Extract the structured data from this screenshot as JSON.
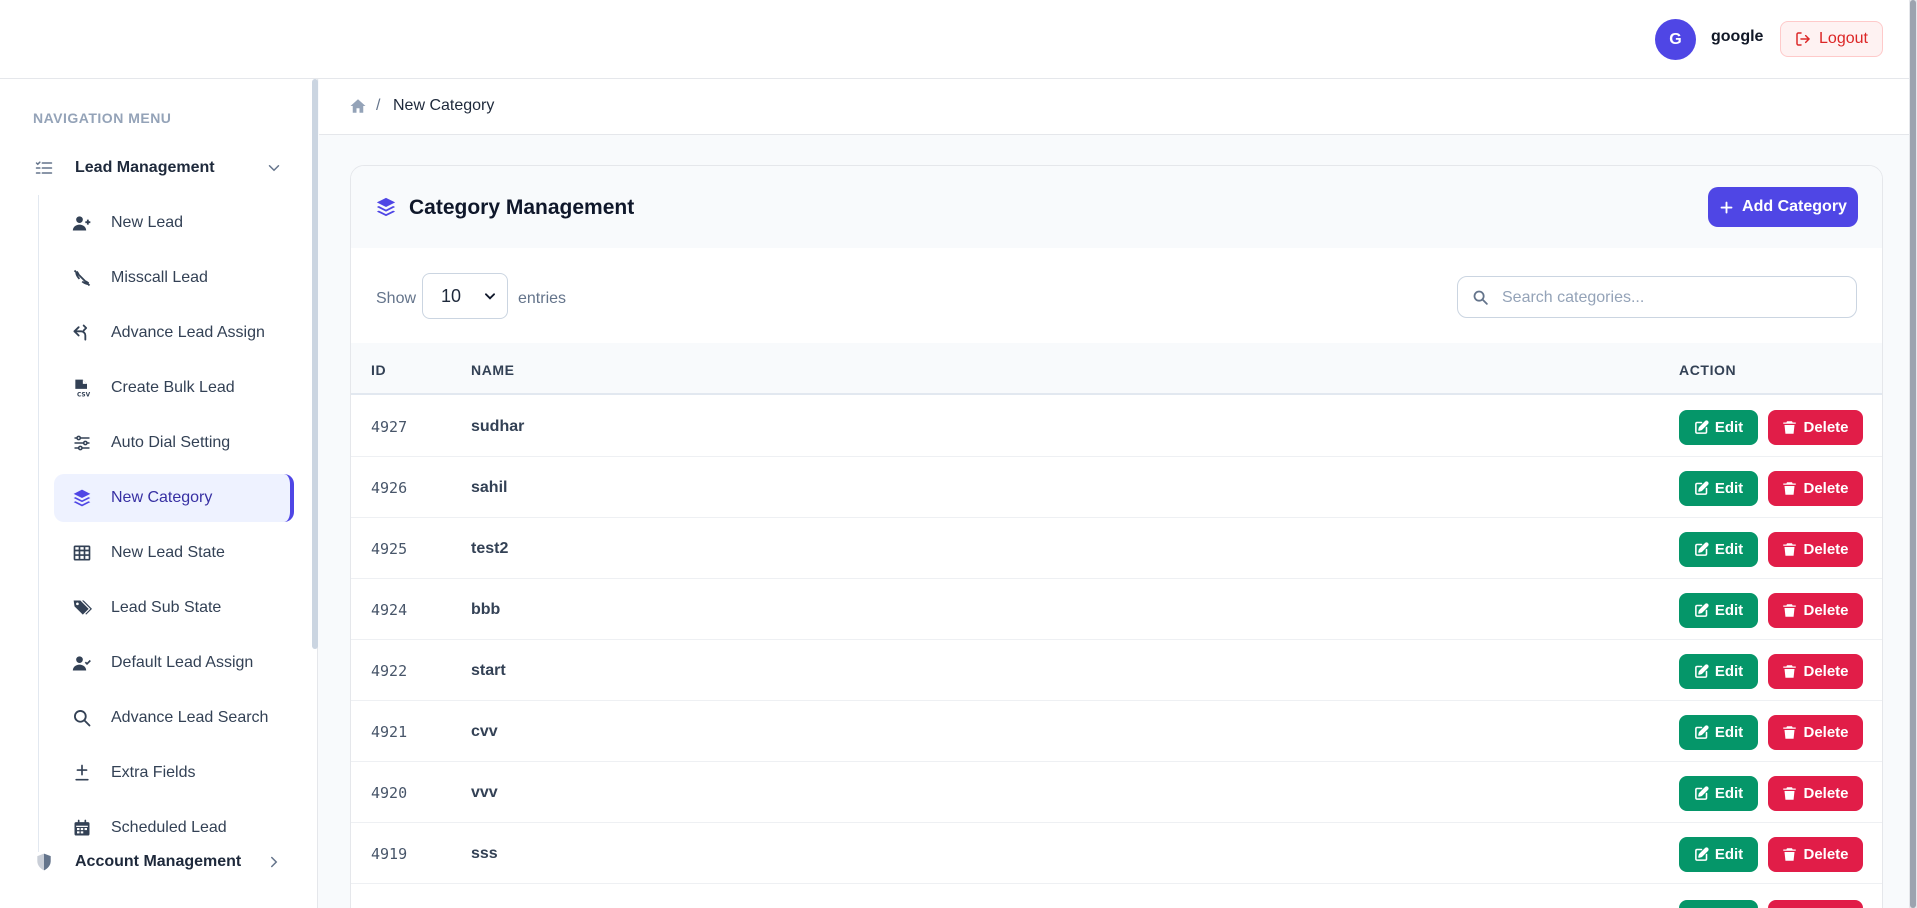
{
  "header": {
    "avatar_initial": "G",
    "username": "google",
    "logout_label": "Logout"
  },
  "sidebar": {
    "heading": "NAVIGATION MENU",
    "group_lead": "Lead Management",
    "items": [
      {
        "label": "New Lead",
        "icon": "user-plus-icon"
      },
      {
        "label": "Misscall Lead",
        "icon": "phone-slash-icon"
      },
      {
        "label": "Advance Lead Assign",
        "icon": "share-arrows-icon"
      },
      {
        "label": "Create Bulk Lead",
        "icon": "file-csv-icon"
      },
      {
        "label": "Auto Dial Setting",
        "icon": "sliders-icon"
      },
      {
        "label": "New Category",
        "icon": "layers-icon",
        "active": true
      },
      {
        "label": "New Lead State",
        "icon": "table-icon"
      },
      {
        "label": "Lead Sub State",
        "icon": "tags-icon"
      },
      {
        "label": "Default Lead Assign",
        "icon": "user-check-icon"
      },
      {
        "label": "Advance Lead Search",
        "icon": "search-icon"
      },
      {
        "label": "Extra Fields",
        "icon": "plus-minus-icon"
      },
      {
        "label": "Scheduled Lead",
        "icon": "calendar-icon"
      }
    ],
    "group_account": "Account Management"
  },
  "breadcrumb": {
    "current": "New Category",
    "separator": "/"
  },
  "card": {
    "title": "Category Management",
    "add_label": "Add Category",
    "show_label": "Show",
    "entries_value": "10",
    "entries_label": "entries",
    "search_placeholder": "Search categories..."
  },
  "table": {
    "headers": {
      "id": "ID",
      "name": "NAME",
      "action": "ACTION"
    },
    "edit_label": "Edit",
    "delete_label": "Delete",
    "rows": [
      {
        "id": "4927",
        "name": "sudhar"
      },
      {
        "id": "4926",
        "name": "sahil"
      },
      {
        "id": "4925",
        "name": "test2"
      },
      {
        "id": "4924",
        "name": "bbb"
      },
      {
        "id": "4922",
        "name": "start"
      },
      {
        "id": "4921",
        "name": "cvv"
      },
      {
        "id": "4920",
        "name": "vvv"
      },
      {
        "id": "4919",
        "name": "sss"
      }
    ]
  },
  "colors": {
    "primary": "#4f46e5",
    "edit": "#059669",
    "delete": "#e11d48",
    "logout": "#dc2626"
  }
}
